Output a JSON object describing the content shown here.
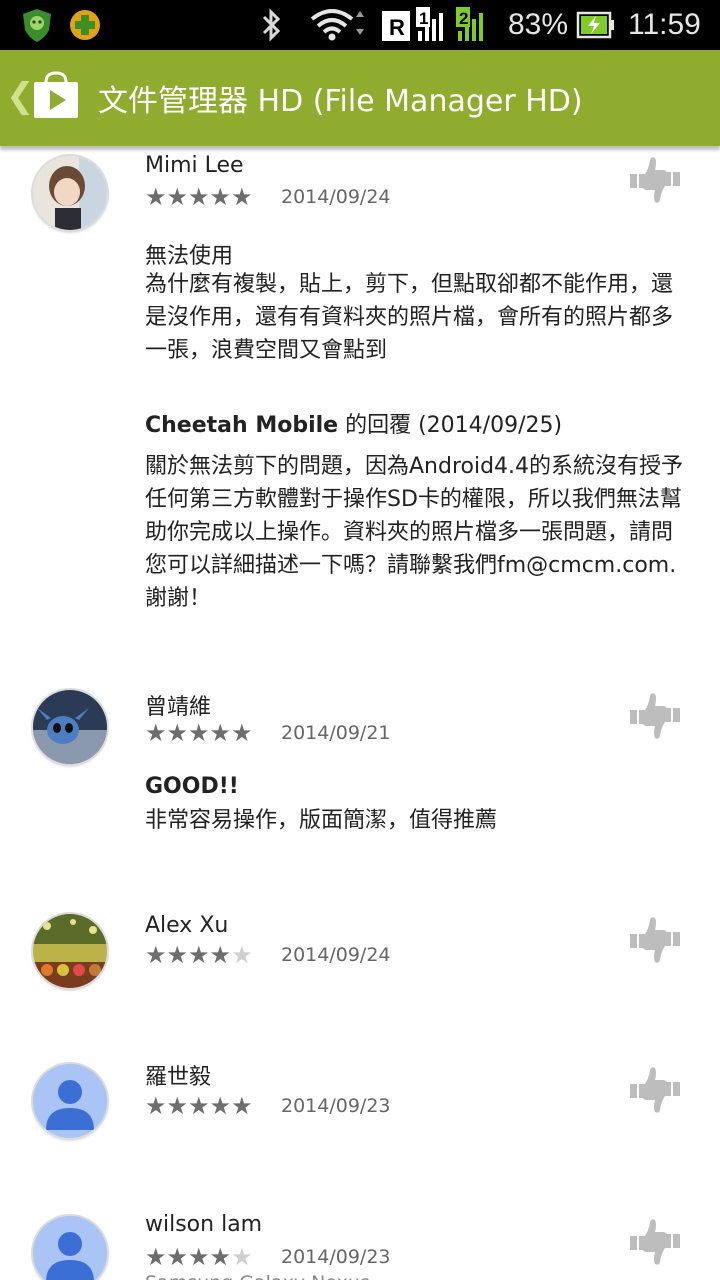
{
  "status_bar": {
    "battery_percent": "83%",
    "time": "11:59",
    "roaming_label": "R",
    "sim1_label": "1",
    "sim2_label": "2",
    "icons": [
      "app-shield-icon",
      "game-pad-icon",
      "bluetooth-icon",
      "wifi-icon",
      "signal-sim1-icon",
      "signal-sim2-icon",
      "battery-charging-icon"
    ]
  },
  "action_bar": {
    "title": "文件管理器 HD (File Manager HD)",
    "icons": [
      "up-caret-icon",
      "play-store-bag-icon"
    ],
    "color": "#8fac2f"
  },
  "reviews": [
    {
      "author": "Mimi Lee",
      "rating": 5,
      "date": "2014/09/24",
      "title": "無法使用",
      "body": "為什麼有複製，貼上，剪下，但點取卻都不能作用，還是沒作用，還有有資料夾的照片檔，會所有的照片都多一張，浪費空間又會點到",
      "reply": {
        "developer": "Cheetah Mobile",
        "label": " 的回覆 ",
        "date": "(2014/09/25)",
        "body": "關於無法剪下的問題，因為Android4.4的系統沒有授予任何第三方軟體對于操作SD卡的權限，所以我們無法幫助你完成以上操作。資料夾的照片檔多一張問題，請問您可以詳細描述一下嗎？請聯繫我們fm@cmcm.com. 謝謝！"
      }
    },
    {
      "author": "曾靖維",
      "rating": 5,
      "date": "2014/09/21",
      "title": "GOOD!!",
      "body": "非常容易操作，版面簡潔，值得推薦"
    },
    {
      "author": "Alex Xu",
      "rating": 4,
      "date": "2014/09/24"
    },
    {
      "author": "羅世毅",
      "rating": 5,
      "date": "2014/09/23"
    },
    {
      "author": "wilson lam",
      "rating": 4,
      "date": "2014/09/23",
      "device": "Samsung Galaxy Nexus"
    }
  ]
}
